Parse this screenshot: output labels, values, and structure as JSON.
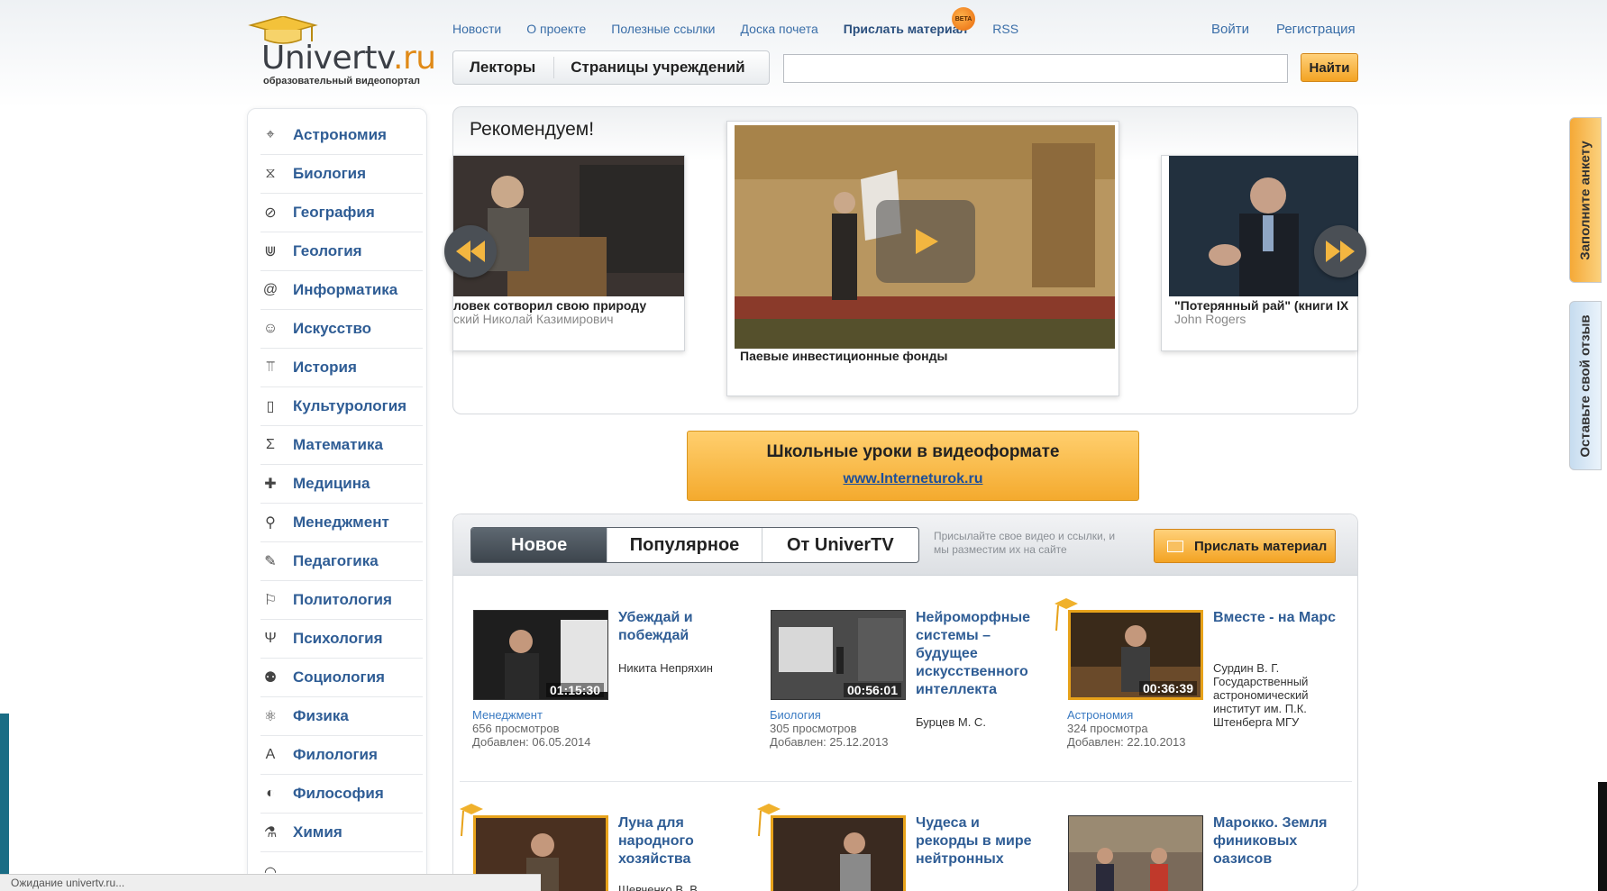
{
  "logo": {
    "name": "Univertv",
    "tld": ".ru",
    "tagline": "образовательный видеопортал"
  },
  "topnav": [
    "Новости",
    "О проекте",
    "Полезные ссылки",
    "Доска почета",
    "Прислать материал",
    "RSS"
  ],
  "beta": "BETA",
  "auth": {
    "login": "Войти",
    "register": "Регистрация"
  },
  "lecturer_tabs": {
    "lecturers": "Лекторы",
    "institutions": "Страницы учреждений"
  },
  "search": {
    "value": "",
    "button": "Найти"
  },
  "categories": [
    {
      "label": "Астрономия",
      "icon": "telescope-icon",
      "glyph": "⌖"
    },
    {
      "label": "Биология",
      "icon": "dna-icon",
      "glyph": "⧖"
    },
    {
      "label": "География",
      "icon": "compass-icon",
      "glyph": "⊘"
    },
    {
      "label": "Геология",
      "icon": "rock-icon",
      "glyph": "⋓"
    },
    {
      "label": "Информатика",
      "icon": "at-icon",
      "glyph": "@"
    },
    {
      "label": "Искусство",
      "icon": "mask-icon",
      "glyph": "☺"
    },
    {
      "label": "История",
      "icon": "column-icon",
      "glyph": "⫪"
    },
    {
      "label": "Культурология",
      "icon": "book-icon",
      "glyph": "▯"
    },
    {
      "label": "Математика",
      "icon": "sigma-icon",
      "glyph": "Σ"
    },
    {
      "label": "Медицина",
      "icon": "cross-icon",
      "glyph": "✚"
    },
    {
      "label": "Менеджмент",
      "icon": "person-icon",
      "glyph": "⚲"
    },
    {
      "label": "Педагогика",
      "icon": "teacher-icon",
      "glyph": "✎"
    },
    {
      "label": "Политология",
      "icon": "flag-icon",
      "glyph": "⚐"
    },
    {
      "label": "Психология",
      "icon": "psi-icon",
      "glyph": "Ψ"
    },
    {
      "label": "Социология",
      "icon": "people-icon",
      "glyph": "⚉"
    },
    {
      "label": "Физика",
      "icon": "atom-icon",
      "glyph": "⚛"
    },
    {
      "label": "Филология",
      "icon": "letter-a-icon",
      "glyph": "A"
    },
    {
      "label": "Философия",
      "icon": "yin-yang-icon",
      "glyph": "◐"
    },
    {
      "label": "Химия",
      "icon": "flask-icon",
      "glyph": "⚗"
    },
    {
      "label": "",
      "icon": "partial-icon",
      "glyph": "◠"
    }
  ],
  "recommend": {
    "title": "Рекомендуем!",
    "left_card": {
      "title": "ловек сотворил свою природу",
      "author": "ский Николай Казимирович"
    },
    "center_card": {
      "title": "Паевые инвестиционные фонды"
    },
    "right_card": {
      "title": "\"Потерянный рай\" (книги IX",
      "author": "John Rogers"
    }
  },
  "banner": {
    "title": "Школьные уроки в видеоформате",
    "link": "www.Interneturok.ru"
  },
  "sections": {
    "tabs": [
      "Новое",
      "Популярное",
      "От UniverTV"
    ],
    "hint": "Присылайте свое видео и ссылки, и мы разместим их на сайте",
    "send_button": "Прислать материал"
  },
  "videos": [
    {
      "title": "Убеждай и побеждай",
      "author": "Никита Непряхин",
      "duration": "01:15:30",
      "category": "Менеджмент",
      "views": "656 просмотров",
      "added": "Добавлен: 06.05.2014",
      "featured": false
    },
    {
      "title": "Нейроморфные системы – будущее искусственного интеллекта",
      "author": "Бурцев М. С.",
      "duration": "00:56:01",
      "category": "Биология",
      "views": "305 просмотров",
      "added": "Добавлен: 25.12.2013",
      "featured": false
    },
    {
      "title": "Вместе - на Марс",
      "author": "Сурдин В. Г. Государственный астрономический институт им. П.К. Штенберга МГУ",
      "duration": "00:36:39",
      "category": "Астрономия",
      "views": "324 просмотра",
      "added": "Добавлен: 22.10.2013",
      "featured": true
    },
    {
      "title": "Луна для народного хозяйства",
      "author": "Шевченко В. В.",
      "featured": true
    },
    {
      "title": "Чудеса и рекорды в мире нейтронных",
      "featured": true
    },
    {
      "title": "Марокко. Земля финиковых оазисов",
      "featured": false
    }
  ],
  "side_tabs": {
    "survey": "Заполните анкету",
    "feedback": "Оставьте свой отзыв"
  },
  "status": "Ожидание univertv.ru..."
}
